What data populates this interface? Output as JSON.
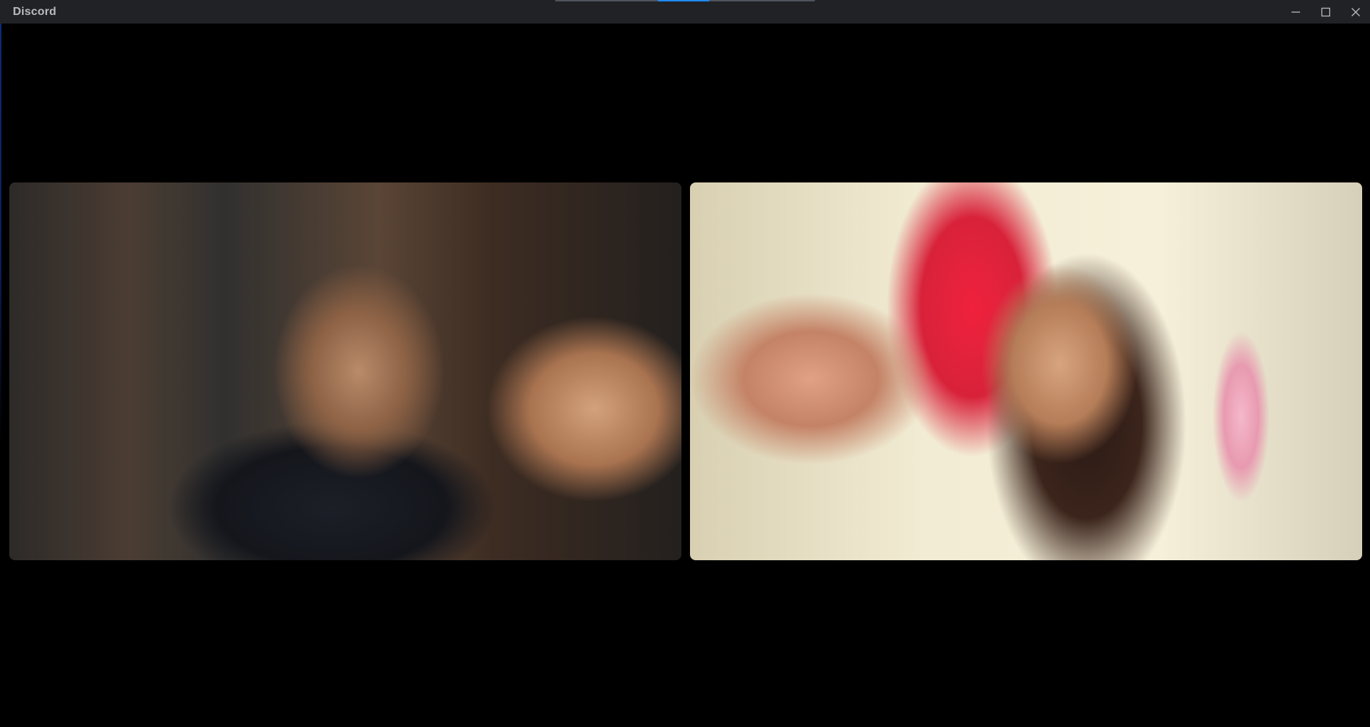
{
  "window": {
    "title": "Discord",
    "controls": {
      "minimize_icon": "minimize-icon",
      "maximize_icon": "maximize-icon",
      "close_icon": "close-icon"
    },
    "update_progress": 0.2
  },
  "colors": {
    "titlebar_bg": "#202225",
    "title_text": "#b9bbbe",
    "progress_fill": "#1f8bff",
    "stage_bg": "#000000"
  },
  "call": {
    "video_tiles": [
      {
        "description_icon": "video-feed"
      },
      {
        "description_icon": "video-feed"
      }
    ]
  }
}
